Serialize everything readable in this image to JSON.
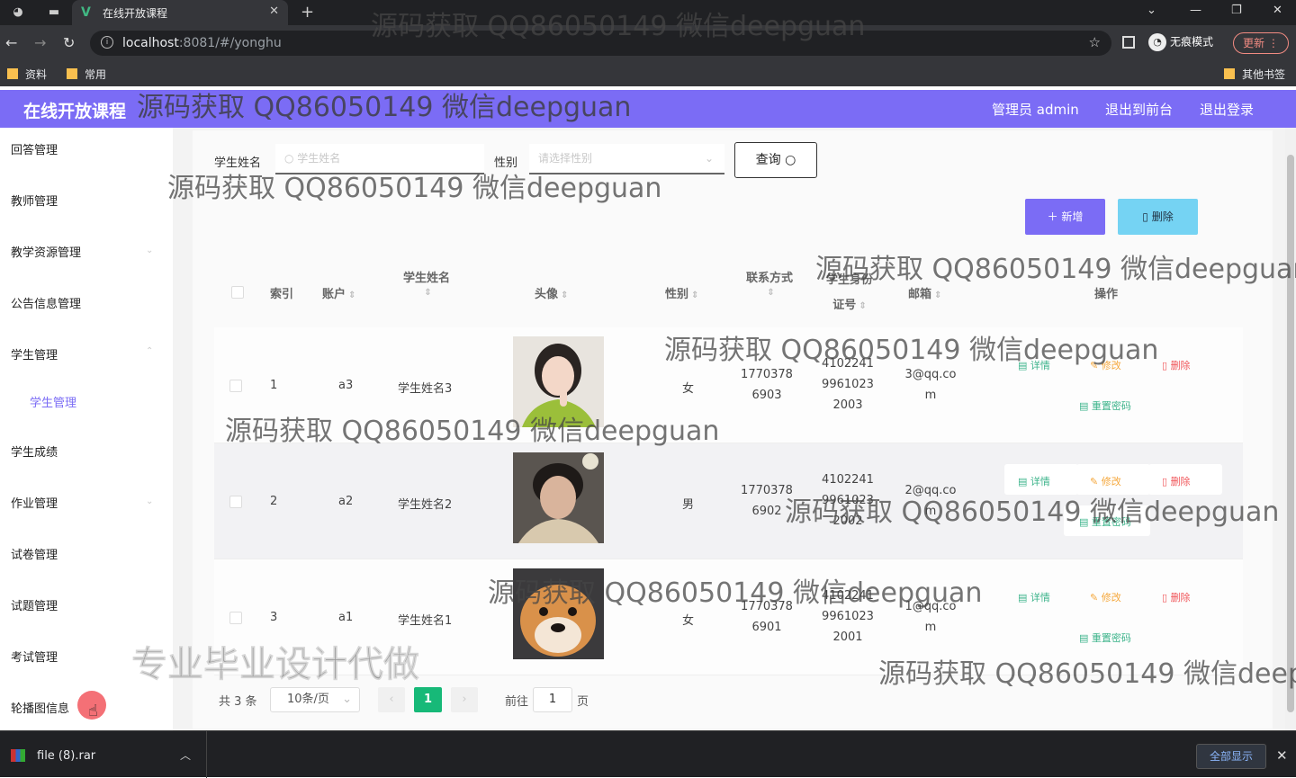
{
  "browser": {
    "tab_title": "在线开放课程",
    "url_host": "localhost",
    "url_rest": ":8081/#/yonghu",
    "incognito_label": "无痕模式",
    "update_label": "更新",
    "bookmarks": [
      "资料",
      "常用"
    ],
    "other_bookmarks": "其他书签"
  },
  "app": {
    "title": "在线开放课程",
    "admin_label": "管理员 admin",
    "to_front_label": "退出到前台",
    "logout_label": "退出登录"
  },
  "sidebar": {
    "items": [
      "回答管理",
      "教师管理",
      "教学资源管理",
      "公告信息管理",
      "学生管理",
      "学生成绩",
      "作业管理",
      "试卷管理",
      "试题管理",
      "考试管理",
      "轮播图信息"
    ],
    "sub_item": "学生管理"
  },
  "filters": {
    "name_label": "学生姓名",
    "name_placeholder": "学生姓名",
    "gender_label": "性别",
    "gender_placeholder": "请选择性别",
    "query_label": "查询"
  },
  "actions": {
    "add_label": "新增",
    "delete_label": "删除"
  },
  "table": {
    "headers": {
      "index": "索引",
      "account": "账户",
      "name": "学生姓名",
      "avatar": "头像",
      "gender": "性别",
      "phone": "联系方式",
      "idcard": "学生身份证号",
      "email": "邮箱",
      "ops": "操作"
    },
    "rows": [
      {
        "index": "1",
        "account": "a3",
        "name": "学生姓名3",
        "gender": "女",
        "phone": "17703786903",
        "idcard": "410224199610232003",
        "email": "3@qq.com"
      },
      {
        "index": "2",
        "account": "a2",
        "name": "学生姓名2",
        "gender": "男",
        "phone": "17703786902",
        "idcard": "410224199610232002",
        "email": "2@qq.com"
      },
      {
        "index": "3",
        "account": "a1",
        "name": "学生姓名1",
        "gender": "女",
        "phone": "17703786901",
        "idcard": "410224199610232001",
        "email": "1@qq.com"
      }
    ],
    "row_actions": {
      "detail": "详情",
      "edit": "修改",
      "delete": "删除",
      "reset": "重置密码"
    }
  },
  "pagination": {
    "total": "共 3 条",
    "page_size": "10条/页",
    "current": "1",
    "goto_label": "前往",
    "goto_value": "1",
    "page_suffix": "页"
  },
  "download": {
    "file_name": "file (8).rar",
    "show_all": "全部显示"
  },
  "watermark": {
    "text": "源码获取 QQ86050149 微信deepguan",
    "text_cut": "源码获取 QQ86050149 微信deep",
    "promo": "专业毕业设计代做"
  }
}
